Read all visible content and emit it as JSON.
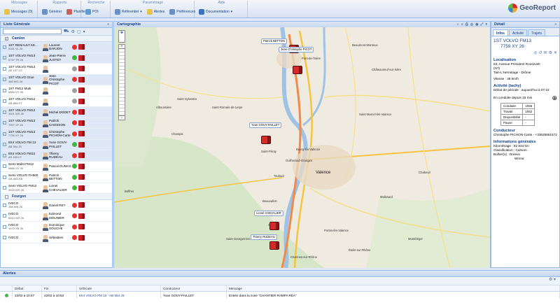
{
  "toolbar": {
    "groups": [
      {
        "title": "Messages",
        "buttons": [
          {
            "label": "Messages (0)",
            "icon": "envelope-icon"
          }
        ]
      },
      {
        "title": "Rapports",
        "buttons": [
          {
            "label": "Générer",
            "icon": "report-icon"
          },
          {
            "label": "Planifier",
            "icon": "calendar-icon"
          }
        ]
      },
      {
        "title": "Recherche",
        "buttons": [
          {
            "label": "POI",
            "icon": "poi-icon"
          }
        ]
      },
      {
        "title": "Paramétrage",
        "buttons": [
          {
            "label": "Référentiel",
            "icon": "referentiel-icon",
            "dropdown": true
          },
          {
            "label": "Alertes",
            "icon": "bell-icon"
          },
          {
            "label": "Préférences",
            "icon": "preferences-icon"
          }
        ]
      },
      {
        "title": "Aide",
        "buttons": [
          {
            "label": "Documentation",
            "icon": "help-icon",
            "dropdown": true
          }
        ]
      }
    ],
    "logo": "GeoReport"
  },
  "sidebar": {
    "title": "Liste Générale",
    "sections": [
      {
        "name": "Camion",
        "rows": [
          {
            "vehicle": "1ST RENAULT KE...",
            "plate": "5161 VL 26",
            "driver": "Laurent BARJON",
            "status": "#e3342f",
            "checked": true
          },
          {
            "vehicle": "1ST VOLVO FM13",
            "plate": "5797 TR 26",
            "driver": "Jean-Pierre JUSTET",
            "status": "#3fb63f",
            "checked": true
          },
          {
            "vehicle": "1ST VOLVO FM13",
            "plate": "AE 137 CS",
            "driver": "",
            "status": "#9e9e9e",
            "checked": false
          },
          {
            "vehicle": "1ST VOLVO Grue",
            "plate": "380 WG 26",
            "driver": "Jean Christophe PICOT",
            "status": "#e3342f",
            "checked": true
          },
          {
            "vehicle": "1ST FM12 Multi",
            "plate": "6884 VV 26",
            "driver": "",
            "status": "#9e9e9e",
            "checked": false
          },
          {
            "vehicle": "1ST VOLVO FM12",
            "plate": "AR-865-FT",
            "driver": "",
            "status": "#9e9e9e",
            "checked": false
          },
          {
            "vehicle": "1ST VOLVO FM12",
            "plate": "3921 WS 26",
            "driver": "Michel DODET",
            "status": "#e3342f",
            "checked": true
          },
          {
            "vehicle": "1ST VOLVO FM13",
            "plate": "7997 XF 26",
            "driver": "Patrick CHOSSON",
            "status": "#e3342f",
            "checked": true
          },
          {
            "vehicle": "1ST VOLVO FM13",
            "plate": "7759 XY 26",
            "driver": "Christophe PICHON-Carte",
            "status": "#e3342f",
            "checked": true
          },
          {
            "vehicle": "8X4 VOLVO FM 13",
            "plate": "AB 554 JS",
            "driver": "Yvan GOUY-PAILLET",
            "status": "#3fb63f",
            "checked": true
          },
          {
            "vehicle": "8X4 VOLVO FM13",
            "plate": "AS 163 LF",
            "driver": "Thierry RUDEAU",
            "status": "#e3342f",
            "checked": true
          },
          {
            "vehicle": "Semi Mulet FM12",
            "plate": "9866 VV 26",
            "driver": "Pascal DUMAS",
            "status": "#3fb63f",
            "checked": false
          },
          {
            "vehicle": "Semi VOLVO FH500",
            "plate": "AR-465-EB",
            "driver": "Patrick BETTON",
            "status": "#3fb63f",
            "checked": false
          },
          {
            "vehicle": "Semi VOLVO FM12",
            "plate": "3923 WS 26",
            "driver": "Lionel CHEVALIER",
            "status": "#3fb63f",
            "checked": false
          }
        ]
      },
      {
        "name": "Fourgon",
        "rows": [
          {
            "vehicle": "IVECO",
            "plate": "138 WN 26",
            "driver": "Daniel REY",
            "status": "#e3342f",
            "checked": false
          },
          {
            "vehicle": "IVECO",
            "plate": "6314 WZ 26",
            "driver": "Edmond MOUNIER",
            "status": "#e3342f",
            "checked": false
          },
          {
            "vehicle": "IVECO",
            "plate": "1970 XB 26",
            "driver": "Dominique SOUCHE",
            "status": "#e3342f",
            "checked": false
          },
          {
            "vehicle": "IVECO",
            "plate": "",
            "driver": "Sébastien",
            "status": "#e3342f",
            "checked": false
          }
        ]
      }
    ]
  },
  "map": {
    "title": "Cartographie",
    "towns": [
      {
        "name": "Beaumont-Monteux"
      },
      {
        "name": "Pont-de-l'Isère"
      },
      {
        "name": "Châteauneuf-sur-Isère"
      },
      {
        "name": "Saint-Sylvestre"
      },
      {
        "name": "Saint-Romain-de-Lerps"
      },
      {
        "name": "Champis"
      },
      {
        "name": "Saint-Marcel-lès-Valence"
      },
      {
        "name": "Saint-Péray"
      },
      {
        "name": "Bourg-lès-Valence"
      },
      {
        "name": "Guilherand-Granges"
      },
      {
        "name": "Valence"
      },
      {
        "name": "Chabeuil"
      },
      {
        "name": "Toulaud"
      },
      {
        "name": "Boffres"
      },
      {
        "name": "Beauvallon"
      },
      {
        "name": "Soyons"
      },
      {
        "name": "Portes-lès-Valence"
      },
      {
        "name": "Étoile-sur-Rhône"
      },
      {
        "name": "Charmes-sur-Rhône"
      },
      {
        "name": "Alboussière"
      },
      {
        "name": "Montéléger"
      },
      {
        "name": "Malissard"
      },
      {
        "name": "Saint-Georges-les-Bains"
      }
    ],
    "markers": [
      "Patrick BETTON",
      "Jean Christophe PICOT",
      "Yvan GOUY-PAILLET",
      "Lionel CHEVALIER",
      "Thierry RUDEAU"
    ]
  },
  "detail": {
    "title": "Détail",
    "tabs": [
      "Infos",
      "Activité",
      "Trajets"
    ],
    "vehicle_line1": "1ST VOLVO FM13",
    "vehicle_line2": "7759 XY 26",
    "localisation_h": "Localisation",
    "address1": "63, Avenue Président Roosevelt",
    "address2": "(N7)",
    "address3": "Tain-L'Hermitage - Drôme",
    "speed": "Vitesse : 48 km/h",
    "activity_h": "Activité (tachy)",
    "period": "Début de période : aujourd'hui à 07:22",
    "driving": "En conduite depuis 15 min",
    "tachy": [
      [
        "Conduite",
        "1h55"
      ],
      [
        "Travail",
        "1h52"
      ],
      [
        "Disponibilité",
        "-"
      ],
      [
        "Pause",
        "-"
      ]
    ],
    "driver_h": "Conducteur",
    "driver_name": "Christophe PICHON-Carte - +33625591572",
    "general_h": "Informations générales",
    "km": "Kilométrage : 82 834 km",
    "classification": "Classification : Camion",
    "boitier": "Boîtier(s) : Dreevo",
    "boitier2": "Wirma"
  },
  "alerts": {
    "title": "Alertes",
    "columns": [
      "Début",
      "Fin",
      "Véhicule",
      "Conducteur",
      "Message"
    ],
    "rows": [
      {
        "start": "22/02 à 10:47",
        "end": "22/02 à 10:53",
        "vehicle": "8X4 VOLVO FM 13 - AB 554 JS",
        "driver": "Yvan GOUY-PAILLET",
        "message": "Entrée dans la zone \"CHANTIER RAMPA RÉA\""
      }
    ]
  }
}
